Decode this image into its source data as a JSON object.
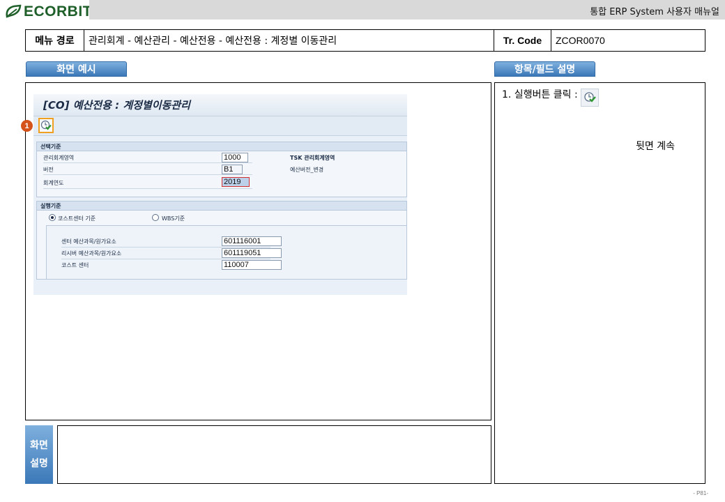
{
  "header": {
    "logo_text": "ECORBIT",
    "doc_title": "통합 ERP System 사용자 매뉴얼"
  },
  "menu_path": {
    "label": "메뉴 경로",
    "value": "관리회계 - 예산관리 - 예산전용 - 예산전용 : 계정별 이동관리",
    "tr_label": "Tr. Code",
    "tr_value": "ZCOR0070"
  },
  "sections": {
    "screen_example": "화면 예시",
    "field_description": "항목/필드 설명",
    "screen_desc_line1": "화면",
    "screen_desc_line2": "설명"
  },
  "sap_screen": {
    "title": "[CO] 예산전용 : 계정별이동관리",
    "marker": "1",
    "selection_group": {
      "heading": "선택기준",
      "rows": [
        {
          "label": "관리회계영역",
          "value": "1000",
          "desc": "TSK 관리회계영역"
        },
        {
          "label": "버전",
          "value": "B1",
          "desc": "예산버전_변경"
        },
        {
          "label": "회계연도",
          "value": "2019",
          "desc": ""
        }
      ]
    },
    "execution_group": {
      "heading": "실행기준",
      "radio_cost_center": "코스트센터 기준",
      "radio_wbs": "WBS기준",
      "rows": [
        {
          "label": "센터 예산과목/원가요소",
          "value": "601116001"
        },
        {
          "label": "리시버 예산과목/원가요소",
          "value": "601119051"
        },
        {
          "label": "코스트 센터",
          "value": "110007"
        }
      ]
    }
  },
  "description": {
    "step1": "1.  실행버튼 클릭 :",
    "continue": "뒷면 계속"
  },
  "footer": {
    "page": "- P81-"
  },
  "colors": {
    "brand_green": "#1f5f2a",
    "tab_blue": "#3b78b8",
    "marker_orange": "#d5531a"
  }
}
